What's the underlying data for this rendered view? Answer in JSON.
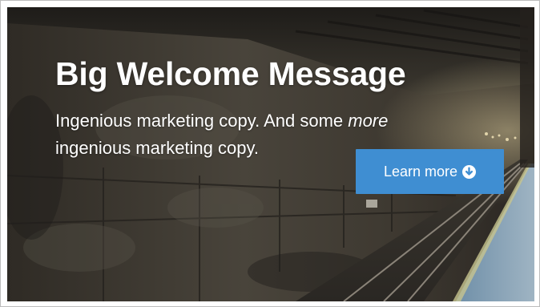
{
  "hero": {
    "headline": "Big Welcome Message",
    "copy_line1_start": "Ingenious marketing copy. And some ",
    "copy_emphasis": "more",
    "copy_line2": "ingenious marketing copy."
  },
  "cta": {
    "label": "Learn more",
    "icon": "arrow-circle-down-icon",
    "color": "#3f8ed2"
  }
}
